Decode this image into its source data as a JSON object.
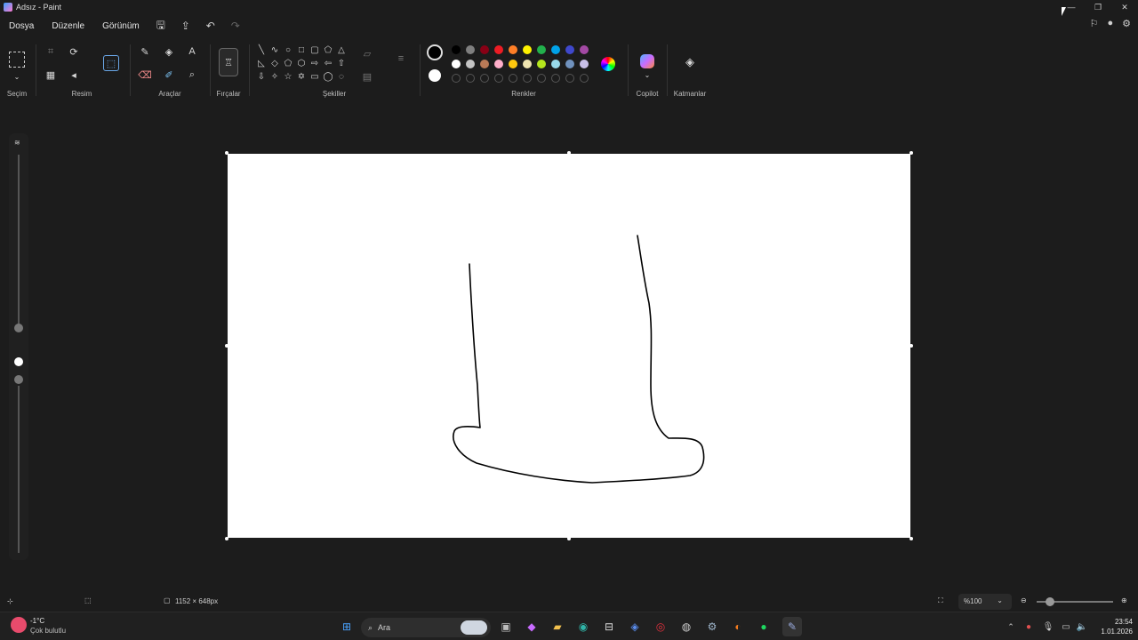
{
  "window": {
    "title": "Adsız - Paint"
  },
  "menu": {
    "items": [
      "Dosya",
      "Düzenle",
      "Görünüm"
    ]
  },
  "ribbon": {
    "groups": {
      "selection": "Seçim",
      "image": "Resim",
      "tools": "Araçlar",
      "brushes": "Fırçalar",
      "shapes": "Şekiller",
      "colors": "Renkler",
      "copilot": "Copilot",
      "layers": "Katmanlar"
    },
    "text_tool_glyph": "A",
    "palette_row1": [
      "#000000",
      "#7f7f7f",
      "#880015",
      "#ed1c24",
      "#ff7f27",
      "#fff200",
      "#22b14c",
      "#00a2e8",
      "#3f48cc",
      "#a349a4"
    ],
    "palette_row2": [
      "#ffffff",
      "#c3c3c3",
      "#b97a57",
      "#ffaec9",
      "#ffc90e",
      "#efe4b0",
      "#b5e61d",
      "#99d9ea",
      "#7092be",
      "#c8bfe7"
    ]
  },
  "status": {
    "canvas_size": "1152 × 648px",
    "zoom": "%100"
  },
  "taskbar": {
    "weather_temp": "-1°C",
    "weather_desc": "Çok bulutlu",
    "search_placeholder": "Ara",
    "time": "23:54",
    "date": "1.01.2026"
  }
}
